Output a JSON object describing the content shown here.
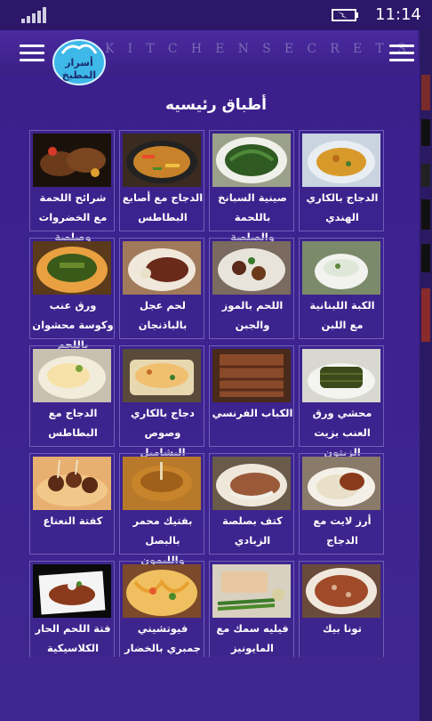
{
  "status": {
    "time": "11:14",
    "signal_icon": "signal-bars-icon",
    "battery_icon": "battery-charging-icon"
  },
  "app_bar": {
    "title": "KITCHENSECRETS",
    "logo_text": "أسرار المطبخ",
    "left_menu_icon": "hamburger-menu-icon",
    "right_menu_icon": "hamburger-menu-icon"
  },
  "section_title": "أطباق رئيسيه",
  "colors": {
    "background": "#3d2290",
    "status_bar": "#2c1769",
    "card_border": "#6f5fb8",
    "logo": "#3db8e8"
  },
  "dishes": [
    {
      "name": "شرائح اللحمة مع الخضروات وصلصة"
    },
    {
      "name": "الدجاج مع أصابع البطاطس"
    },
    {
      "name": "صينية السبانخ باللحمة والصلصة"
    },
    {
      "name": "الدجاج بالكاري الهندي"
    },
    {
      "name": "ورق عنب وكوسة محشوان باللحم"
    },
    {
      "name": "لحم عجل بالباذنجان"
    },
    {
      "name": "اللحم بالموز والجبن"
    },
    {
      "name": "الكبة اللبنانية مع اللبن"
    },
    {
      "name": "الدجاج مع البطاطس"
    },
    {
      "name": "دجاج بالكاري وصوص البشاميل"
    },
    {
      "name": "الكباب الفرنسي"
    },
    {
      "name": "محشي ورق العنب بزيت الزيتون"
    },
    {
      "name": "كفتة النعناع"
    },
    {
      "name": "بفتيك محمر بالبصل والليمون"
    },
    {
      "name": "كتف بصلصة الزبادي"
    },
    {
      "name": "أرز لايت مع الدجاج"
    },
    {
      "name": "فتة اللحم الحار الكلاسيكية"
    },
    {
      "name": "فيوتشيني جمبري بالخضار"
    },
    {
      "name": "فيليه سمك مع المايونيز"
    },
    {
      "name": "تونا بيك"
    }
  ]
}
